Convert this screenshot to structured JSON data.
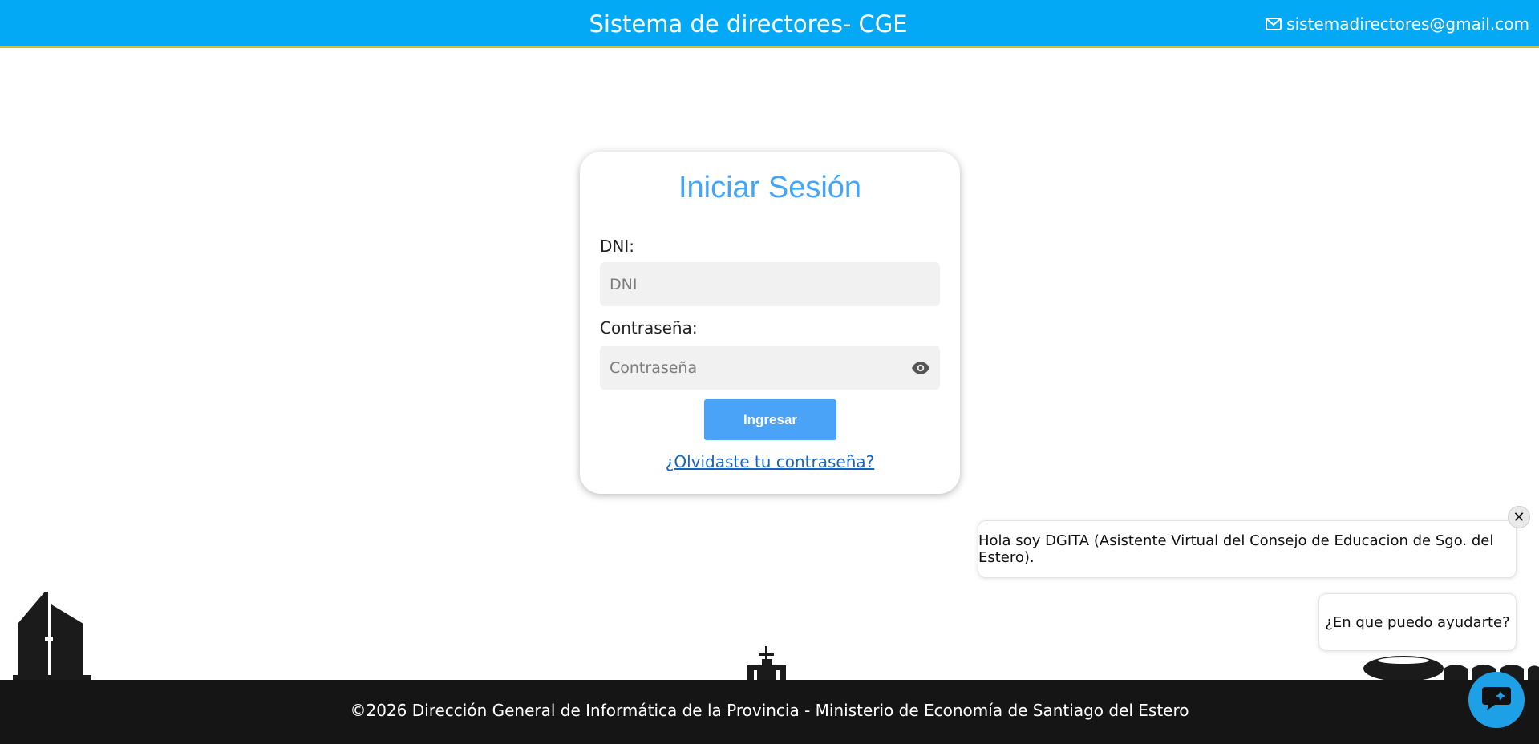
{
  "header": {
    "title": "Sistema de directores- CGE",
    "email": "sistemadirectores@gmail.com",
    "email_icon": "envelope-icon"
  },
  "login": {
    "title": "Iniciar Sesión",
    "dni_label": "DNI:",
    "dni_placeholder": "DNI",
    "dni_value": "",
    "password_label": "Contraseña:",
    "password_placeholder": "Contraseña",
    "password_value": "",
    "toggle_icon": "eye-icon",
    "submit_label": "Ingresar",
    "forgot_label": "¿Olvidaste tu contraseña?"
  },
  "chat": {
    "greeting": "Hola soy DGITA (Asistente Virtual del Consejo de Educacion de Sgo. del Estero).",
    "question": "¿En que puedo ayudarte?",
    "close_glyph": "✕",
    "close_icon": "close-icon",
    "launcher_icon": "chat-icon"
  },
  "footer": {
    "text": "©2026 Dirección General de Informática de la Provincia - Ministerio de Economía de Santiago del Estero"
  },
  "colors": {
    "header_bg": "#03a9f4",
    "accent": "#42a5f5",
    "button": "#4aa3f7",
    "footer_bg": "#151515",
    "chat_launcher": "#1ea0e6"
  }
}
